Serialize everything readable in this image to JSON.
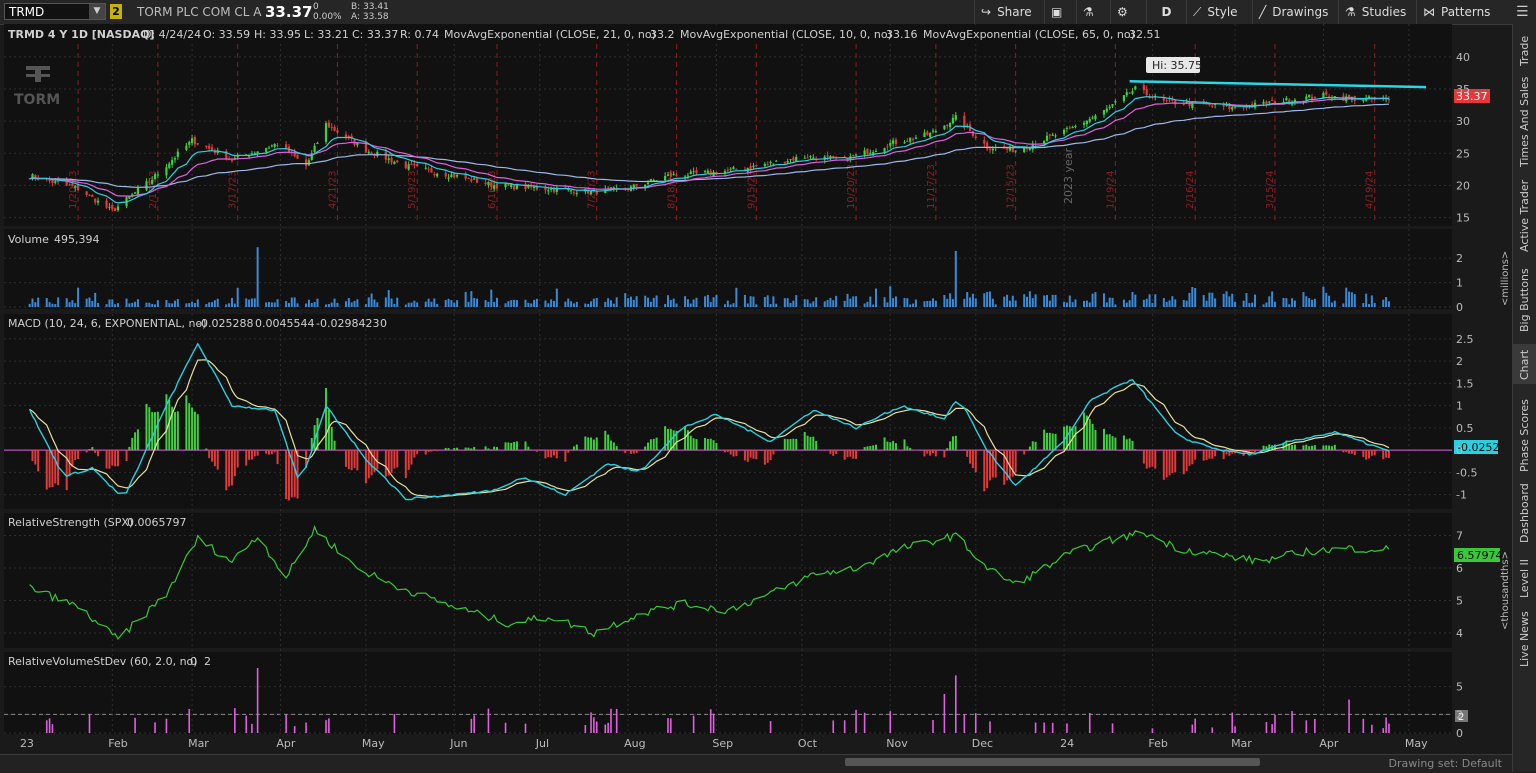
{
  "toolbar": {
    "symbol": "TRMD",
    "link_badge": "2",
    "company": "TORM PLC COM CL A",
    "last": "33.37",
    "change": "0",
    "change_pct": "0.00%",
    "bid": "B: 33.41",
    "ask": "A: 33.58",
    "share_label": "Share",
    "aggregation_label": "D",
    "style_label": "Style",
    "drawings_label": "Drawings",
    "studies_label": "Studies",
    "patterns_label": "Patterns"
  },
  "side_tabs": [
    "Trade",
    "Times And Sales",
    "Active Trader",
    "Big Buttons",
    "Chart",
    "Phase Scores",
    "Dashboard",
    "Level II",
    "Live News"
  ],
  "price_header": {
    "title": "TRMD 4 Y 1D [NASDAQ]",
    "date": "D: 4/24/24",
    "open": "O: 33.59",
    "high": "H: 33.95",
    "low": "L: 33.21",
    "close": "C: 33.37",
    "range": "R: 0.74",
    "ema21_label": "MovAvgExponential (CLOSE, 21, 0, no)",
    "ema21_value": "33.2",
    "ema10_label": "MovAvgExponential (CLOSE, 10, 0, no)",
    "ema10_value": "33.16",
    "ema65_label": "MovAvgExponential (CLOSE, 65, 0, no)",
    "ema65_value": "32.51",
    "logo_text": "TORM",
    "hi_label": "Hi: 35.75",
    "year_label": "2023 year",
    "vertical_date_labels": [
      "1/20/23",
      "2/17/23",
      "3/17/23",
      "4/21/23",
      "5/19/23",
      "6/16/23",
      "7/21/23",
      "8/18/23",
      "9/15/23",
      "10/20/23",
      "11/17/23",
      "12/15/23",
      "1/19/24",
      "2/16/24",
      "3/15/24",
      "4/19/24"
    ],
    "last_badge": "33.37"
  },
  "volume_header": {
    "label": "Volume",
    "value": "495,394",
    "axis_unit": "<millions>"
  },
  "macd_header": {
    "label": "MACD (10, 24, 6, EXPONENTIAL, no)",
    "value": "-0.025288",
    "avg": "0.0045544",
    "diff": "-0.0298423",
    "zero": "0",
    "last_badge": "-0.0252"
  },
  "rs_header": {
    "label": "RelativeStrength (SPX)",
    "value": "0.0065797",
    "last_badge": "6.57974",
    "axis_unit": "<thousandths>"
  },
  "rvs_header": {
    "label": "RelativeVolumeStDev (60, 2.0, no)",
    "v1": "0",
    "v2": "2",
    "last_badge": "2"
  },
  "footer": {
    "drawing_set": "Drawing set: Default"
  },
  "colors": {
    "up": "#3fcf3f",
    "down": "#e03a3a",
    "ema21": "#e060e0",
    "ema10": "#28d0e0",
    "ema65": "#9ab8e8",
    "macd": "#28d0e0",
    "signal": "#e8e0a0",
    "rs": "#38c838",
    "rvs": "#e060e0",
    "volume": "#3a8ad8",
    "trend": "#28d8e8"
  },
  "chart_data": [
    {
      "type": "candlestick",
      "title": "TRMD 4 Y 1D [NASDAQ]",
      "ylim": [
        14,
        42
      ],
      "y_ticks": [
        15,
        20,
        25,
        30,
        35,
        40
      ],
      "x_month_labels": [
        "23",
        "Feb",
        "Mar",
        "Apr",
        "May",
        "Jun",
        "Jul",
        "Aug",
        "Sep",
        "Oct",
        "Nov",
        "Dec",
        "24",
        "Feb",
        "Mar",
        "Apr",
        "May"
      ],
      "close_anchors": [
        [
          "2023-01-03",
          21.5
        ],
        [
          "2023-01-20",
          19.5
        ],
        [
          "2023-02-01",
          16.0
        ],
        [
          "2023-02-15",
          21.0
        ],
        [
          "2023-03-01",
          27.0
        ],
        [
          "2023-03-15",
          24.0
        ],
        [
          "2023-03-31",
          26.5
        ],
        [
          "2023-04-10",
          23.0
        ],
        [
          "2023-04-17",
          29.5
        ],
        [
          "2023-05-01",
          25.5
        ],
        [
          "2023-05-15",
          23.0
        ],
        [
          "2023-06-01",
          21.5
        ],
        [
          "2023-06-15",
          20.0
        ],
        [
          "2023-07-03",
          19.5
        ],
        [
          "2023-07-20",
          19.0
        ],
        [
          "2023-08-01",
          19.5
        ],
        [
          "2023-08-15",
          21.5
        ],
        [
          "2023-09-01",
          22.0
        ],
        [
          "2023-09-15",
          23.0
        ],
        [
          "2023-10-02",
          24.5
        ],
        [
          "2023-10-16",
          24.0
        ],
        [
          "2023-11-01",
          26.5
        ],
        [
          "2023-11-15",
          28.0
        ],
        [
          "2023-11-24",
          30.5
        ],
        [
          "2023-12-05",
          26.0
        ],
        [
          "2023-12-15",
          25.5
        ],
        [
          "2024-01-02",
          28.5
        ],
        [
          "2024-01-15",
          31.5
        ],
        [
          "2024-01-26",
          35.0
        ],
        [
          "2024-02-05",
          33.0
        ],
        [
          "2024-02-20",
          32.5
        ],
        [
          "2024-03-01",
          32.0
        ],
        [
          "2024-03-15",
          33.0
        ],
        [
          "2024-04-01",
          34.0
        ],
        [
          "2024-04-10",
          33.5
        ],
        [
          "2024-04-24",
          33.37
        ]
      ],
      "high": 35.75,
      "ema21_last": 33.2,
      "ema10_last": 33.16,
      "ema65_last": 32.51,
      "trendline": [
        [
          "2024-01-24",
          36.2
        ],
        [
          "2024-05-07",
          35.3
        ]
      ]
    },
    {
      "type": "bar",
      "series_name": "Volume",
      "unit": "millions",
      "ylim": [
        0,
        2.5
      ],
      "y_ticks": [
        0,
        1,
        2
      ],
      "spikes": [
        [
          "2023-03-24",
          2.45
        ],
        [
          "2023-11-24",
          2.3
        ]
      ],
      "last": 0.495394
    },
    {
      "type": "line",
      "series_name": "MACD (10, 24, 6, EXPONENTIAL, no)",
      "ylim": [
        -1.3,
        2.7
      ],
      "y_ticks": [
        -1,
        -0.5,
        0,
        0.5,
        1,
        1.5,
        2,
        2.5
      ],
      "macd_anchors": [
        [
          "2023-01-03",
          0.9
        ],
        [
          "2023-01-15",
          -0.6
        ],
        [
          "2023-01-25",
          -0.4
        ],
        [
          "2023-02-05",
          -1.1
        ],
        [
          "2023-02-20",
          1.0
        ],
        [
          "2023-03-03",
          2.4
        ],
        [
          "2023-03-15",
          1.0
        ],
        [
          "2023-03-30",
          0.9
        ],
        [
          "2023-04-08",
          -0.8
        ],
        [
          "2023-04-17",
          1.0
        ],
        [
          "2023-05-01",
          -0.2
        ],
        [
          "2023-05-15",
          -1.1
        ],
        [
          "2023-06-01",
          -1.0
        ],
        [
          "2023-06-15",
          -0.9
        ],
        [
          "2023-06-25",
          -0.6
        ],
        [
          "2023-07-10",
          -1.0
        ],
        [
          "2023-07-25",
          -0.3
        ],
        [
          "2023-08-05",
          -0.5
        ],
        [
          "2023-08-20",
          0.5
        ],
        [
          "2023-09-01",
          0.8
        ],
        [
          "2023-09-20",
          0.2
        ],
        [
          "2023-10-05",
          0.9
        ],
        [
          "2023-10-20",
          0.5
        ],
        [
          "2023-11-05",
          1.0
        ],
        [
          "2023-11-20",
          0.7
        ],
        [
          "2023-11-25",
          1.2
        ],
        [
          "2023-12-05",
          0.0
        ],
        [
          "2023-12-15",
          -0.8
        ],
        [
          "2024-01-01",
          0.2
        ],
        [
          "2024-01-10",
          1.1
        ],
        [
          "2024-01-25",
          1.6
        ],
        [
          "2024-02-10",
          0.3
        ],
        [
          "2024-02-25",
          0.0
        ],
        [
          "2024-03-08",
          -0.1
        ],
        [
          "2024-03-20",
          0.2
        ],
        [
          "2024-04-05",
          0.4
        ],
        [
          "2024-04-24",
          -0.025288
        ]
      ],
      "value": -0.025288,
      "avg": 0.0045544,
      "diff": -0.0298423
    },
    {
      "type": "line",
      "series_name": "RelativeStrength (SPX)",
      "unit": "thousandths",
      "ylim": [
        3.6,
        7.2
      ],
      "y_ticks": [
        4,
        5,
        6,
        7
      ],
      "anchors": [
        [
          "2023-01-03",
          5.4
        ],
        [
          "2023-01-20",
          4.8
        ],
        [
          "2023-02-03",
          3.8
        ],
        [
          "2023-02-20",
          5.2
        ],
        [
          "2023-03-03",
          6.9
        ],
        [
          "2023-03-15",
          6.2
        ],
        [
          "2023-03-24",
          7.0
        ],
        [
          "2023-04-03",
          5.7
        ],
        [
          "2023-04-13",
          7.2
        ],
        [
          "2023-04-28",
          6.0
        ],
        [
          "2023-05-10",
          5.5
        ],
        [
          "2023-06-01",
          4.8
        ],
        [
          "2023-06-20",
          4.3
        ],
        [
          "2023-07-05",
          4.5
        ],
        [
          "2023-07-20",
          4.0
        ],
        [
          "2023-08-05",
          4.6
        ],
        [
          "2023-08-20",
          4.9
        ],
        [
          "2023-09-05",
          4.7
        ],
        [
          "2023-09-20",
          5.2
        ],
        [
          "2023-10-05",
          5.8
        ],
        [
          "2023-10-20",
          6.0
        ],
        [
          "2023-11-05",
          6.6
        ],
        [
          "2023-11-24",
          7.0
        ],
        [
          "2023-12-05",
          6.0
        ],
        [
          "2023-12-15",
          5.5
        ],
        [
          "2024-01-02",
          6.4
        ],
        [
          "2024-01-15",
          6.8
        ],
        [
          "2024-01-29",
          7.1
        ],
        [
          "2024-02-10",
          6.6
        ],
        [
          "2024-02-25",
          6.4
        ],
        [
          "2024-03-10",
          6.2
        ],
        [
          "2024-03-25",
          6.5
        ],
        [
          "2024-04-10",
          6.6
        ],
        [
          "2024-04-24",
          6.57974
        ]
      ],
      "value": 6.57974
    },
    {
      "type": "bar",
      "series_name": "RelativeVolumeStDev (60, 2.0, no)",
      "ylim": [
        0,
        7
      ],
      "y_ticks": [
        0,
        2,
        5
      ],
      "threshold": 2,
      "spikes": [
        [
          "2023-03-24",
          7.0
        ],
        [
          "2023-11-24",
          6.2
        ],
        [
          "2023-08-20",
          3.0
        ],
        [
          "2023-11-20",
          4.2
        ],
        [
          "2024-04-10",
          3.6
        ]
      ],
      "last": 2
    }
  ]
}
